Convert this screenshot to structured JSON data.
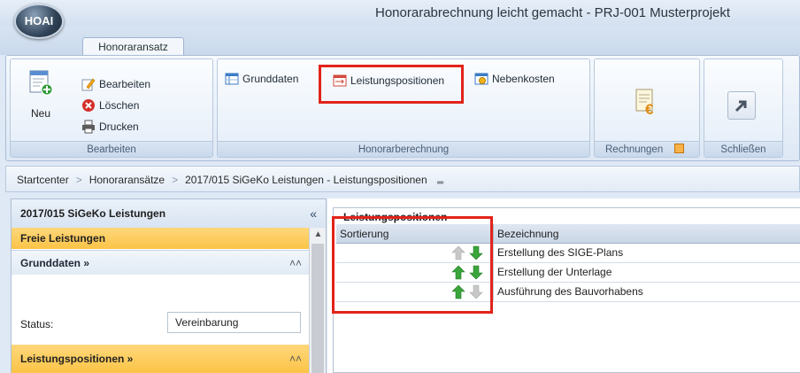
{
  "app": {
    "logo_text": "HOAI",
    "window_title": "Honorarabrechnung leicht gemacht - PRJ-001 Musterprojekt"
  },
  "ribbon": {
    "tab_label": "Honoraransatz",
    "groups": {
      "bearbeiten": {
        "label": "Bearbeiten",
        "neu": "Neu",
        "bearbeiten": "Bearbeiten",
        "loeschen": "Löschen",
        "drucken": "Drucken"
      },
      "honorarberechnung": {
        "label": "Honorarberechnung",
        "grunddaten": "Grunddaten",
        "leistungspositionen": "Leistungspositionen",
        "nebenkosten": "Nebenkosten"
      },
      "rechnungen": {
        "label": "Rechnungen"
      },
      "schliessen": {
        "label": "Schließen"
      }
    }
  },
  "breadcrumb": {
    "items": [
      "Startcenter",
      "Honoraransätze",
      "2017/015 SiGeKo Leistungen - Leistungspositionen"
    ]
  },
  "left_panel": {
    "header": "2017/015 SiGeKo Leistungen",
    "collapse_glyph": "«",
    "freie_leistungen": "Freie Leistungen",
    "grunddaten_section": "Grunddaten »",
    "status_label": "Status:",
    "status_value": "Vereinbarung",
    "leistungspositionen_section": "Leistungspositionen »"
  },
  "right_panel": {
    "legend": "Leistungspositionen",
    "columns": [
      "Sortierung",
      "Bezeichnung"
    ],
    "rows": [
      {
        "bezeichnung": "Erstellung des SIGE-Plans",
        "up_enabled": false,
        "down_enabled": true
      },
      {
        "bezeichnung": "Erstellung der Unterlage",
        "up_enabled": true,
        "down_enabled": true
      },
      {
        "bezeichnung": "Ausführung des Bauvorhabens",
        "up_enabled": true,
        "down_enabled": false
      }
    ]
  },
  "colors": {
    "highlight_red": "#e2231a",
    "yellow_section": "#fbc447",
    "arrow_green": "#3aa53a",
    "arrow_disabled": "#c8c8c8"
  }
}
